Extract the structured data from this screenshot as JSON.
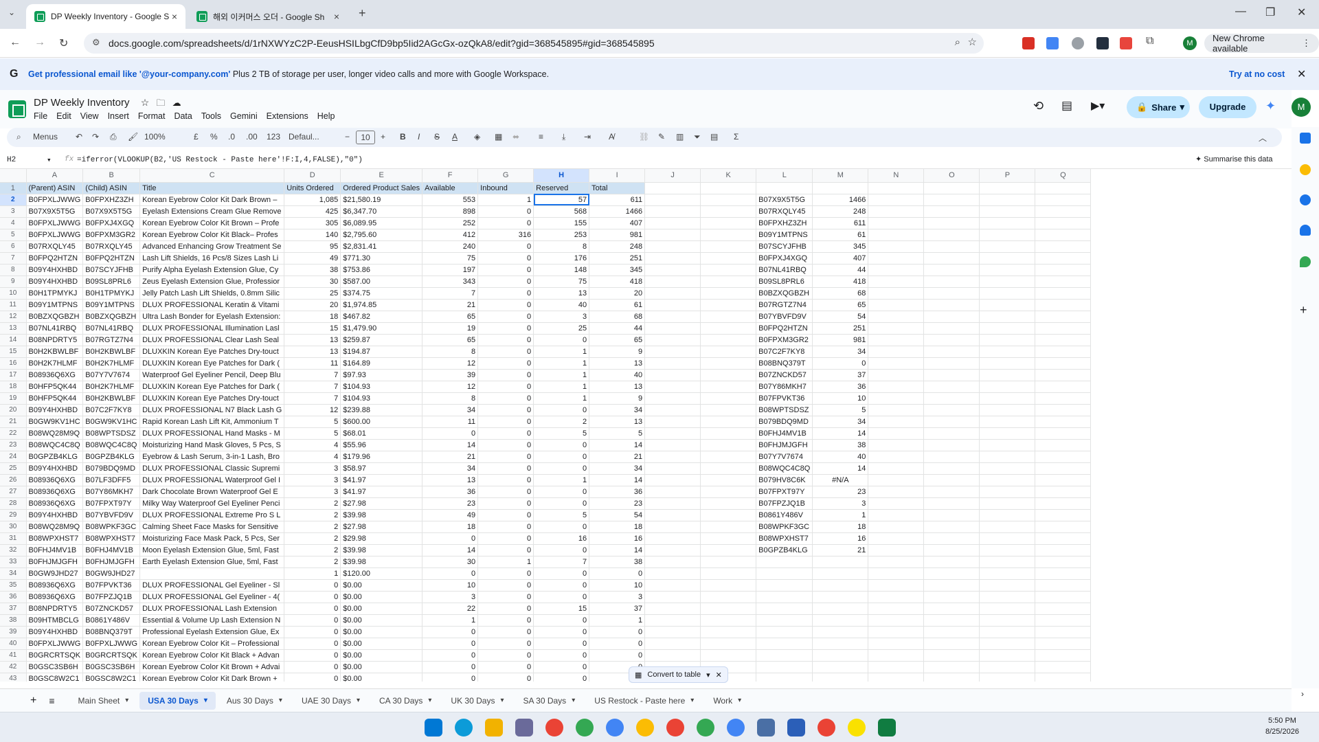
{
  "browser": {
    "tabs": [
      {
        "title": "DP Weekly Inventory - Google S",
        "active": true
      },
      {
        "title": "해외 이커머스 오더 - Google Sh",
        "active": false
      }
    ],
    "url": "docs.google.com/spreadsheets/d/1rNXWYzC2P-EeusHSILbgCfD9bp5Iid2AGcGx-ozQkA8/edit?gid=368545895#gid=368545895",
    "new_chrome_label": "New Chrome available",
    "profile_initial": "M"
  },
  "banner": {
    "bold_text": "Get professional email like '@your-company.com'",
    "text": " Plus 2 TB of storage per user, longer video calls and more with Google Workspace.",
    "cta": "Try at no cost"
  },
  "sheets": {
    "doc_title": "DP Weekly Inventory",
    "menus": [
      "File",
      "Edit",
      "View",
      "Insert",
      "Format",
      "Data",
      "Tools",
      "Gemini",
      "Extensions",
      "Help"
    ],
    "share_label": "Share",
    "upgrade_label": "Upgrade",
    "toolbar": {
      "menus_label": "Menus",
      "zoom": "100%",
      "currency": "£",
      "percent": "%",
      "dec_less": ".0",
      "dec_more": ".00",
      "num_format": "123",
      "font": "Defaul...",
      "font_size": "10",
      "bold": "B",
      "italic": "I",
      "strike": "S",
      "color_a": "A",
      "sum": "Σ"
    },
    "name_box": "H2",
    "formula": "=iferror(VLOOKUP(B2,'US Restock - Paste here'!F:I,4,FALSE),\"0\")",
    "summarise_label": "Summarise this data",
    "columns": [
      "A",
      "B",
      "C",
      "D",
      "E",
      "F",
      "G",
      "H",
      "I",
      "J",
      "K",
      "L",
      "M",
      "N",
      "O",
      "P",
      "Q"
    ],
    "header_row": [
      "(Parent) ASIN",
      "(Child) ASIN",
      "Title",
      "Units Ordered",
      "Ordered Product Sales",
      "Available",
      "Inbound",
      "Reserved",
      "Total"
    ],
    "rows": [
      [
        "B0FPXLJWWG",
        "B0FPXHZ3ZH",
        "Korean Eyebrow Color Kit Dark Brown –",
        "1,085",
        "$21,580.19",
        "553",
        "1",
        "57",
        "611",
        "",
        "",
        "B07X9X5T5G",
        "1466"
      ],
      [
        "B07X9X5T5G",
        "B07X9X5T5G",
        "Eyelash Extensions Cream Glue Remove",
        "425",
        "$6,347.70",
        "898",
        "0",
        "568",
        "1466",
        "",
        "",
        "B07RXQLY45",
        "248"
      ],
      [
        "B0FPXLJWWG",
        "B0FPXJ4XGQ",
        "Korean Eyebrow Color Kit Brown – Profe",
        "305",
        "$6,089.95",
        "252",
        "0",
        "155",
        "407",
        "",
        "",
        "B0FPXHZ3ZH",
        "611"
      ],
      [
        "B0FPXLJWWG",
        "B0FPXM3GR2",
        "Korean Eyebrow Color Kit Black– Profes",
        "140",
        "$2,795.60",
        "412",
        "316",
        "253",
        "981",
        "",
        "",
        "B09Y1MTPNS",
        "61"
      ],
      [
        "B07RXQLY45",
        "B07RXQLY45",
        "Advanced Enhancing Grow Treatment Se",
        "95",
        "$2,831.41",
        "240",
        "0",
        "8",
        "248",
        "",
        "",
        "B07SCYJFHB",
        "345"
      ],
      [
        "B0FPQ2HTZN",
        "B0FPQ2HTZN",
        "Lash Lift Shields, 16 Pcs/8 Sizes Lash Li",
        "49",
        "$771.30",
        "75",
        "0",
        "176",
        "251",
        "",
        "",
        "B0FPXJ4XGQ",
        "407"
      ],
      [
        "B09Y4HXHBD",
        "B07SCYJFHB",
        "Purify Alpha Eyelash Extension Glue, Cy",
        "38",
        "$753.86",
        "197",
        "0",
        "148",
        "345",
        "",
        "",
        "B07NL41RBQ",
        "44"
      ],
      [
        "B09Y4HXHBD",
        "B09SL8PRL6",
        "Zeus Eyelash Extension Glue, Professior",
        "30",
        "$587.00",
        "343",
        "0",
        "75",
        "418",
        "",
        "",
        "B09SL8PRL6",
        "418"
      ],
      [
        "B0H1TPMYKJ",
        "B0H1TPMYKJ",
        "Jelly Patch Lash Lift Shields, 0.8mm Silic",
        "25",
        "$374.75",
        "7",
        "0",
        "13",
        "20",
        "",
        "",
        "B0BZXQGBZH",
        "68"
      ],
      [
        "B09Y1MTPNS",
        "B09Y1MTPNS",
        "DLUX PROFESSIONAL Keratin & Vitami",
        "20",
        "$1,974.85",
        "21",
        "0",
        "40",
        "61",
        "",
        "",
        "B07RGTZ7N4",
        "65"
      ],
      [
        "B0BZXQGBZH",
        "B0BZXQGBZH",
        "Ultra Lash Bonder for Eyelash Extension:",
        "18",
        "$467.82",
        "65",
        "0",
        "3",
        "68",
        "",
        "",
        "B07YBVFD9V",
        "54"
      ],
      [
        "B07NL41RBQ",
        "B07NL41RBQ",
        "DLUX PROFESSIONAL Illumination Lasl",
        "15",
        "$1,479.90",
        "19",
        "0",
        "25",
        "44",
        "",
        "",
        "B0FPQ2HTZN",
        "251"
      ],
      [
        "B08NPDRTY5",
        "B07RGTZ7N4",
        "DLUX PROFESSIONAL Clear Lash Seal",
        "13",
        "$259.87",
        "65",
        "0",
        "0",
        "65",
        "",
        "",
        "B0FPXM3GR2",
        "981"
      ],
      [
        "B0H2KBWLBF",
        "B0H2KBWLBF",
        "DLUXKIN Korean Eye Patches Dry-touct",
        "13",
        "$194.87",
        "8",
        "0",
        "1",
        "9",
        "",
        "",
        "B07C2F7KY8",
        "34"
      ],
      [
        "B0H2K7HLMF",
        "B0H2K7HLMF",
        "DLUXKIN Korean Eye Patches for Dark (",
        "11",
        "$164.89",
        "12",
        "0",
        "1",
        "13",
        "",
        "",
        "B08BNQ379T",
        "0"
      ],
      [
        "B08936Q6XG",
        "B07Y7V7674",
        "Waterproof Gel Eyeliner Pencil, Deep Blu",
        "7",
        "$97.93",
        "39",
        "0",
        "1",
        "40",
        "",
        "",
        "B07ZNCKD57",
        "37"
      ],
      [
        "B0HFP5QK44",
        "B0H2K7HLMF",
        "DLUXKIN Korean Eye Patches for Dark (",
        "7",
        "$104.93",
        "12",
        "0",
        "1",
        "13",
        "",
        "",
        "B07Y86MKH7",
        "36"
      ],
      [
        "B0HFP5QK44",
        "B0H2KBWLBF",
        "DLUXKIN Korean Eye Patches Dry-touct",
        "7",
        "$104.93",
        "8",
        "0",
        "1",
        "9",
        "",
        "",
        "B07FPVKT36",
        "10"
      ],
      [
        "B09Y4HXHBD",
        "B07C2F7KY8",
        "DLUX PROFESSIONAL N7 Black Lash G",
        "12",
        "$239.88",
        "34",
        "0",
        "0",
        "34",
        "",
        "",
        "B08WPTSDSZ",
        "5"
      ],
      [
        "B0GW9KV1HC",
        "B0GW9KV1HC",
        "Rapid Korean Lash Lift Kit, Ammonium T",
        "5",
        "$600.00",
        "11",
        "0",
        "2",
        "13",
        "",
        "",
        "B079BDQ9MD",
        "34"
      ],
      [
        "B08WQ28M9Q",
        "B08WPTSDSZ",
        "DLUX PROFESSIONAL Hand Masks - M",
        "5",
        "$68.01",
        "0",
        "0",
        "5",
        "5",
        "",
        "",
        "B0FHJ4MV1B",
        "14"
      ],
      [
        "B08WQC4C8Q",
        "B08WQC4C8Q",
        "Moisturizing Hand Mask Gloves, 5 Pcs, S",
        "4",
        "$55.96",
        "14",
        "0",
        "0",
        "14",
        "",
        "",
        "B0FHJMJGFH",
        "38"
      ],
      [
        "B0GPZB4KLG",
        "B0GPZB4KLG",
        "Eyebrow & Lash Serum, 3-in-1 Lash, Bro",
        "4",
        "$179.96",
        "21",
        "0",
        "0",
        "21",
        "",
        "",
        "B07Y7V7674",
        "40"
      ],
      [
        "B09Y4HXHBD",
        "B079BDQ9MD",
        "DLUX PROFESSIONAL Classic Supremi",
        "3",
        "$58.97",
        "34",
        "0",
        "0",
        "34",
        "",
        "",
        "B08WQC4C8Q",
        "14"
      ],
      [
        "B08936Q6XG",
        "B07LF3DFF5",
        "DLUX PROFESSIONAL Waterproof Gel I",
        "3",
        "$41.97",
        "13",
        "0",
        "1",
        "14",
        "",
        "",
        "B079HV8C6K",
        "#N/A"
      ],
      [
        "B08936Q6XG",
        "B07Y86MKH7",
        "Dark Chocolate Brown Waterproof Gel E",
        "3",
        "$41.97",
        "36",
        "0",
        "0",
        "36",
        "",
        "",
        "B07FPXT97Y",
        "23"
      ],
      [
        "B08936Q6XG",
        "B07FPXT97Y",
        "Milky Way Waterproof Gel Eyeliner Penci",
        "2",
        "$27.98",
        "23",
        "0",
        "0",
        "23",
        "",
        "",
        "B07FPZJQ1B",
        "3"
      ],
      [
        "B09Y4HXHBD",
        "B07YBVFD9V",
        "DLUX PROFESSIONAL Extreme Pro S L",
        "2",
        "$39.98",
        "49",
        "0",
        "5",
        "54",
        "",
        "",
        "B0861Y486V",
        "1"
      ],
      [
        "B08WQ28M9Q",
        "B08WPKF3GC",
        "Calming Sheet Face Masks for Sensitive",
        "2",
        "$27.98",
        "18",
        "0",
        "0",
        "18",
        "",
        "",
        "B08WPKF3GC",
        "18"
      ],
      [
        "B08WPXHST7",
        "B08WPXHST7",
        "Moisturizing Face Mask Pack, 5 Pcs, Ser",
        "2",
        "$29.98",
        "0",
        "0",
        "16",
        "16",
        "",
        "",
        "B08WPXHST7",
        "16"
      ],
      [
        "B0FHJ4MV1B",
        "B0FHJ4MV1B",
        "Moon Eyelash Extension Glue, 5ml, Fast",
        "2",
        "$39.98",
        "14",
        "0",
        "0",
        "14",
        "",
        "",
        "B0GPZB4KLG",
        "21"
      ],
      [
        "B0FHJMJGFH",
        "B0FHJMJGFH",
        "Earth Eyelash Extension Glue, 5ml, Fast",
        "2",
        "$39.98",
        "30",
        "1",
        "7",
        "38",
        "",
        "",
        "",
        ""
      ],
      [
        "B0GW9JHD27",
        "B0GW9JHD27",
        "",
        "1",
        "$120.00",
        "0",
        "0",
        "0",
        "0",
        "",
        "",
        "",
        ""
      ],
      [
        "B08936Q6XG",
        "B07FPVKT36",
        "DLUX PROFESSIONAL Gel Eyeliner - Sl",
        "0",
        "$0.00",
        "10",
        "0",
        "0",
        "10",
        "",
        "",
        "",
        ""
      ],
      [
        "B08936Q6XG",
        "B07FPZJQ1B",
        "DLUX PROFESSIONAL Gel Eyeliner - 4(",
        "0",
        "$0.00",
        "3",
        "0",
        "0",
        "3",
        "",
        "",
        "",
        ""
      ],
      [
        "B08NPDRTY5",
        "B07ZNCKD57",
        "DLUX PROFESSIONAL Lash Extension",
        "0",
        "$0.00",
        "22",
        "0",
        "15",
        "37",
        "",
        "",
        "",
        ""
      ],
      [
        "B09HTMBCLG",
        "B0861Y486V",
        "Essential & Volume Up Lash Extension N",
        "0",
        "$0.00",
        "1",
        "0",
        "0",
        "1",
        "",
        "",
        "",
        ""
      ],
      [
        "B09Y4HXHBD",
        "B08BNQ379T",
        "Professional Eyelash Extension Glue, Ex",
        "0",
        "$0.00",
        "0",
        "0",
        "0",
        "0",
        "",
        "",
        "",
        ""
      ],
      [
        "B0FPXLJWWG",
        "B0FPXLJWWG",
        "Korean Eyebrow Color Kit – Professional",
        "0",
        "$0.00",
        "0",
        "0",
        "0",
        "0",
        "",
        "",
        "",
        ""
      ],
      [
        "B0GRCRTSQK",
        "B0GRCRTSQK",
        "Korean Eyebrow Color Kit Black + Advan",
        "0",
        "$0.00",
        "0",
        "0",
        "0",
        "0",
        "",
        "",
        "",
        ""
      ],
      [
        "B0GSC3SB6H",
        "B0GSC3SB6H",
        "Korean Eyebrow Color Kit Brown + Advai",
        "0",
        "$0.00",
        "0",
        "0",
        "0",
        "0",
        "",
        "",
        "",
        ""
      ],
      [
        "B0GSC8W2C1",
        "B0GSC8W2C1",
        "Korean Eyebrow Color Kit Dark Brown +",
        "0",
        "$0.00",
        "0",
        "0",
        "0",
        "0",
        "",
        "",
        "",
        ""
      ]
    ],
    "convert_label": "Convert to table",
    "sheet_tabs": [
      "Main Sheet",
      "USA 30 Days",
      "Aus 30 Days",
      "UAE 30 Days",
      "CA 30 Days",
      "UK 30 Days",
      "SA 30 Days",
      "US Restock - Paste here",
      "Work"
    ],
    "active_sheet": "USA 30 Days"
  },
  "taskbar": {
    "time": "5:50 PM",
    "date": "8/25/2026"
  },
  "colors": {
    "header_fill": "#cfe2f3",
    "selection": "#1a73e8",
    "sheets_green": "#0f9d58",
    "share_bg": "#c2e7ff"
  }
}
